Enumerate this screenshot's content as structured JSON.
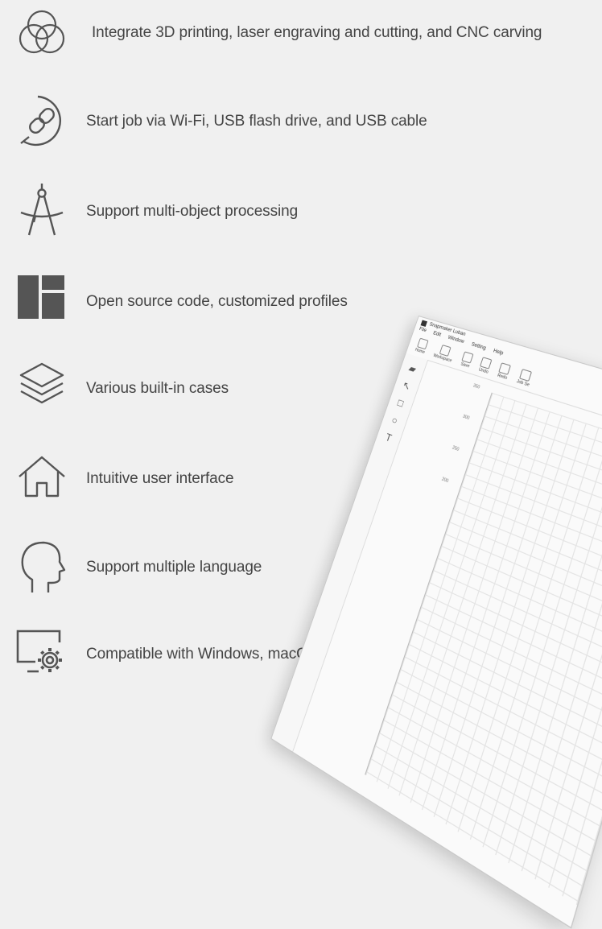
{
  "features": [
    {
      "icon": "circles-overlap-icon",
      "label": "Integrate 3D printing, laser engraving and cutting, and CNC carving"
    },
    {
      "icon": "link-circle-icon",
      "label": "Start job via Wi-Fi, USB flash drive, and USB cable"
    },
    {
      "icon": "compass-icon",
      "label": "Support multi-object processing"
    },
    {
      "icon": "layout-panels-icon",
      "label": "Open source code, customized profiles"
    },
    {
      "icon": "layers-icon",
      "label": "Various built-in cases"
    },
    {
      "icon": "home-icon",
      "label": "Intuitive user interface"
    },
    {
      "icon": "head-profile-icon",
      "label": "Support multiple language"
    },
    {
      "icon": "monitor-gear-icon",
      "label": "Compatible with Windows, macOS, and Linux"
    }
  ],
  "app": {
    "title": "Snapmaker Luban",
    "menu": [
      "File",
      "Edit",
      "Window",
      "Setting",
      "Help"
    ],
    "toolbar": [
      "Home",
      "Workspace",
      "Save",
      "Undo",
      "Redo",
      "Job Se"
    ],
    "yticks": [
      "350",
      "300",
      "250",
      "200"
    ]
  },
  "colors": {
    "background": "#f0f0f0",
    "icon": "#555555",
    "text": "#444444"
  }
}
